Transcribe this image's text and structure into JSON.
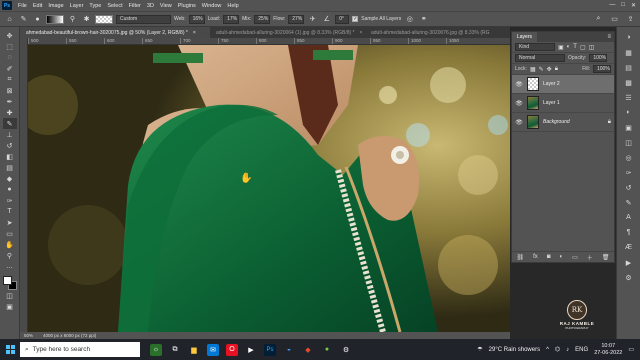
{
  "menubar": {
    "logo": "Ps",
    "items": [
      "File",
      "Edit",
      "Image",
      "Layer",
      "Type",
      "Select",
      "Filter",
      "3D",
      "View",
      "Plugins",
      "Window",
      "Help"
    ],
    "window_controls": [
      "—",
      "□",
      "✕"
    ]
  },
  "options": {
    "mode_value": "Custom",
    "width_label": "Web:",
    "width_value": "16%",
    "flow_label": "Load:",
    "flow_value": "17%",
    "mix_label": "Mix:",
    "mix_value": "25%",
    "flow2_label": "Flow:",
    "flow2_value": "27%",
    "angle_value": "0°",
    "sample_label": "Sample All Layers"
  },
  "tabs": [
    {
      "label": "ahmedabad-beautiful-brown-hair-3020075.jpg @ 50% (Layer 2, RGB/8) *",
      "active": true
    },
    {
      "label": "adult-ahmedabad-alluring-3020064 (1).jpg @ 8.33% (RGB/8) *",
      "active": false
    },
    {
      "label": "adult-ahmedabad-alluring-3020076.jpg @ 8.33% (RG",
      "active": false
    }
  ],
  "ruler": [
    "500",
    "550",
    "600",
    "650",
    "700",
    "750",
    "800",
    "850",
    "900",
    "950",
    "1000",
    "1050"
  ],
  "status": {
    "zoom": "50%",
    "doc_info": "4000 px x 6000 px (72 ppi)"
  },
  "layers_panel": {
    "tab_label": "Layers",
    "kind_label": "Kind",
    "blend_mode": "Normal",
    "opacity_label": "Opacity:",
    "opacity_value": "100%",
    "lock_label": "Lock:",
    "fill_label": "Fill:",
    "fill_value": "100%",
    "layers": [
      {
        "name": "Layer 2",
        "selected": true
      },
      {
        "name": "Layer 1",
        "selected": false
      },
      {
        "name": "Background",
        "selected": false
      }
    ]
  },
  "watermark": {
    "seal": "RK",
    "name": "RAJ KAMBLE",
    "sub": "PHOTOGRAPHY"
  },
  "taskbar": {
    "search_placeholder": "Type here to search",
    "weather": "29°C Rain showers",
    "language": "ENG",
    "time": "10:07",
    "date": "27-06-2022"
  },
  "colors": {
    "ui_dark": "#535353",
    "ui_darker": "#383838",
    "dress_green": "#0f6a3a",
    "skin": "#caa07a",
    "accent_blue": "#31a8ff"
  }
}
